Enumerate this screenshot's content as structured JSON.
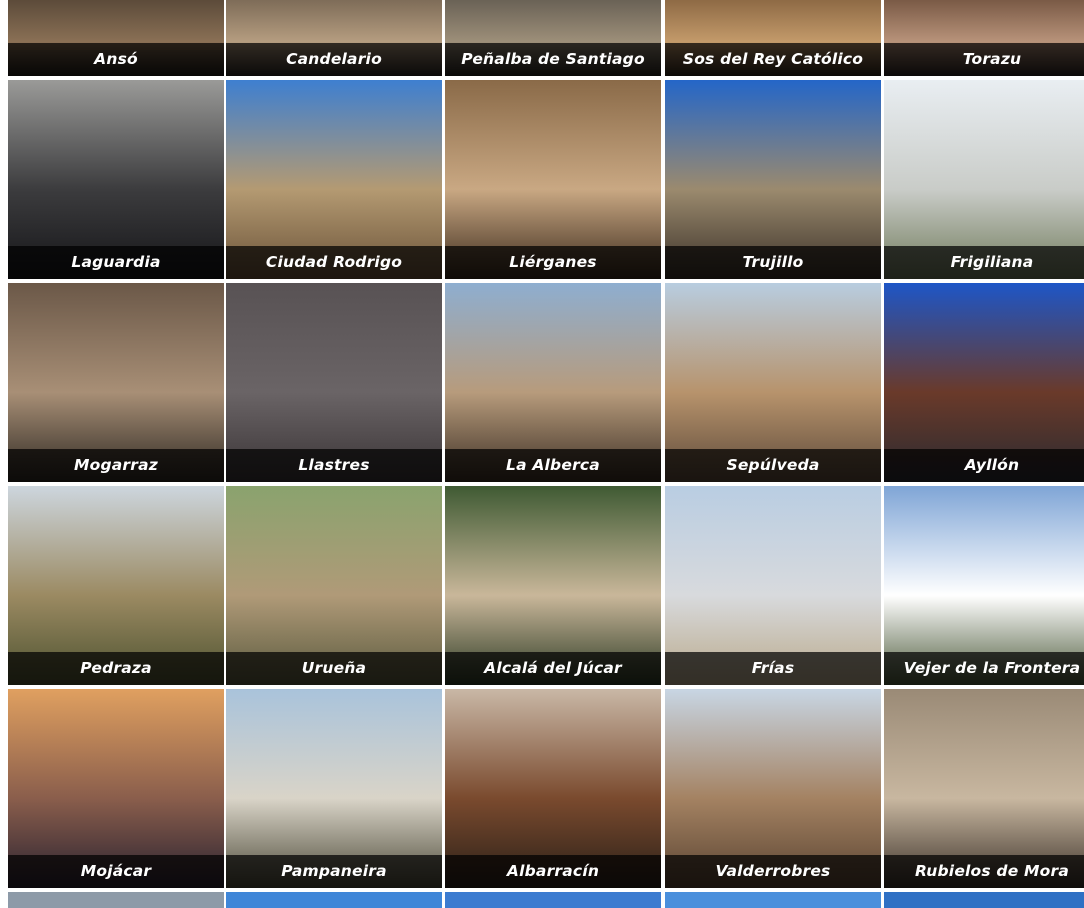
{
  "gallery": {
    "rows": [
      [
        {
          "name": "Ansó",
          "photo": [
            "#5c4b3a",
            "#8a7055",
            "#1d1a16"
          ]
        },
        {
          "name": "Candelario",
          "photo": [
            "#7e6c58",
            "#b59d80",
            "#2a2521"
          ]
        },
        {
          "name": "Peñalba de Santiago",
          "photo": [
            "#6a6256",
            "#9d8f79",
            "#26221d"
          ]
        },
        {
          "name": "Sos del Rey Católico",
          "photo": [
            "#8e6a45",
            "#c39a6a",
            "#2c2218"
          ]
        },
        {
          "name": "Torazu",
          "photo": [
            "#7a5a46",
            "#b8937a",
            "#2a2220"
          ]
        }
      ],
      [
        {
          "name": "Laguardia",
          "photo": [
            "#9a9a98",
            "#3c3c3e",
            "#151518"
          ]
        },
        {
          "name": "Ciudad Rodrigo",
          "photo": [
            "#3e7fd0",
            "#b49a72",
            "#6a5238"
          ]
        },
        {
          "name": "Liérganes",
          "photo": [
            "#8a6a48",
            "#c9a883",
            "#3b2a1c"
          ]
        },
        {
          "name": "Trujillo",
          "photo": [
            "#2466c8",
            "#9b8a6e",
            "#3a3128"
          ]
        },
        {
          "name": "Frigiliana",
          "photo": [
            "#e9eef2",
            "#c9ccc8",
            "#6f7a5a"
          ]
        }
      ],
      [
        {
          "name": "Mogarraz",
          "photo": [
            "#6b5848",
            "#a88f76",
            "#2d2822"
          ]
        },
        {
          "name": "Llastres",
          "photo": [
            "#585254",
            "#6a6466",
            "#3a3436"
          ]
        },
        {
          "name": "La Alberca",
          "photo": [
            "#8eaed0",
            "#b79b7c",
            "#3c2f24"
          ]
        },
        {
          "name": "Sepúlveda",
          "photo": [
            "#b8cde0",
            "#b7936c",
            "#5d4a3a"
          ]
        },
        {
          "name": "Ayllón",
          "photo": [
            "#1e56c7",
            "#6a3a2a",
            "#2a2a30"
          ]
        }
      ],
      [
        {
          "name": "Pedraza",
          "photo": [
            "#cdd6de",
            "#9b8a62",
            "#4d5230"
          ]
        },
        {
          "name": "Urueña",
          "photo": [
            "#8aa36e",
            "#b09a78",
            "#5a5a3e"
          ]
        },
        {
          "name": "Alcalá del Júcar",
          "photo": [
            "#3f5a33",
            "#c9b79a",
            "#2c3a24"
          ]
        },
        {
          "name": "Frías",
          "photo": [
            "#b9cde2",
            "#d8dadd",
            "#b9a98a"
          ]
        },
        {
          "name": "Vejer de la Frontera",
          "photo": [
            "#7fa5d6",
            "#ffffff",
            "#4c5a3a"
          ]
        }
      ],
      [
        {
          "name": "Mojácar",
          "photo": [
            "#e0a060",
            "#8a5e4c",
            "#2a2230"
          ]
        },
        {
          "name": "Pampaneira",
          "photo": [
            "#a9c3db",
            "#d9d4c8",
            "#4d4a38"
          ]
        },
        {
          "name": "Albarracín",
          "photo": [
            "#c9b8a6",
            "#7a4a2e",
            "#2a2018"
          ]
        },
        {
          "name": "Valderrobres",
          "photo": [
            "#c8d6e4",
            "#a48262",
            "#5a4432"
          ]
        },
        {
          "name": "Rubielos de Mora",
          "photo": [
            "#9a8a76",
            "#c8b7a0",
            "#3a3028"
          ]
        }
      ]
    ],
    "next_row_strip_colors": [
      "#8d9aa8",
      "#3f86d8",
      "#3c7bd0",
      "#4a8fdc",
      "#2f70c4"
    ]
  }
}
